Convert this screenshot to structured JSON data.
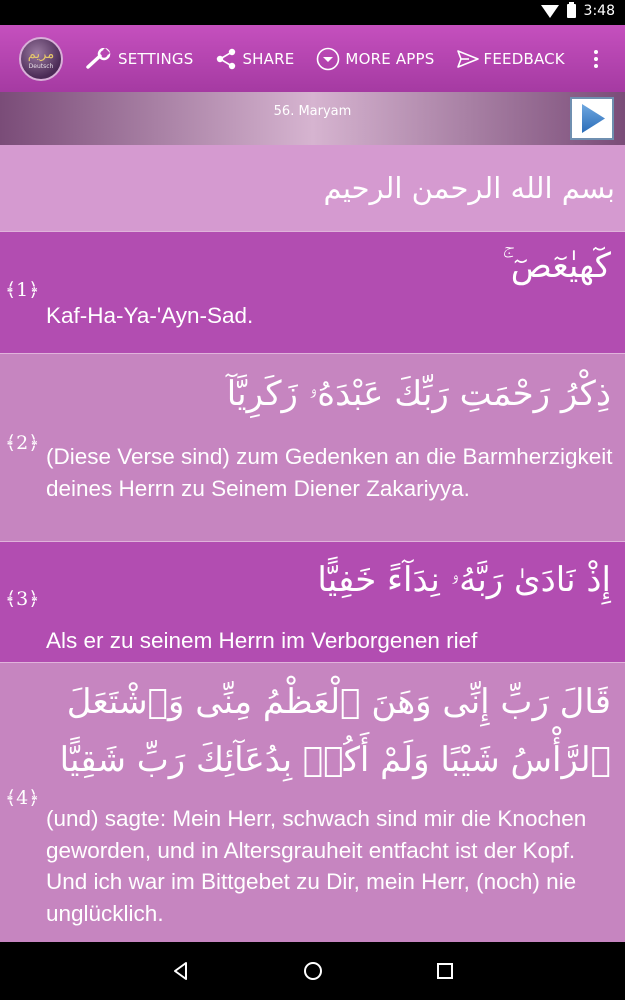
{
  "status_bar": {
    "time": "3:48"
  },
  "toolbar": {
    "logo_arabic": "مريم",
    "logo_language": "Deutsch",
    "settings_label": "SETTINGS",
    "share_label": "SHARE",
    "more_apps_label": "MORE APPS",
    "feedback_label": "FEEDBACK"
  },
  "player": {
    "sura_title": "56. Maryam"
  },
  "bismillah": "بسم الله الرحمن الرحيم",
  "verses": [
    {
      "number": "﴾1﴿",
      "arabic": "كٓهيٰعٓصٓ ۚ",
      "translation": "Kaf-Ha-Ya-'Ayn-Sad."
    },
    {
      "number": "﴾2﴿",
      "arabic": "ذِكْرُ رَحْمَتِ رَبِّكَ عَبْدَهُۥ زَكَرِيَّآ",
      "translation": "(Diese Verse sind) zum Gedenken an die Barmherzigkeit deines Herrn zu Seinem Diener Zakariyya."
    },
    {
      "number": "﴾3﴿",
      "arabic": "إِذْ نَادَىٰ رَبَّهُۥ نِدَآءً خَفِيًّا",
      "translation": "Als er zu seinem Herrn im Verborgenen rief"
    },
    {
      "number": "﴾4﴿",
      "arabic": "قَالَ رَبِّ إِنِّى وَهَنَ ٱلْعَظْمُ مِنِّى وَٱشْتَعَلَ ٱلرَّأْسُ شَيْبًا وَلَمْ أَكُنۢ بِدُعَآئِكَ رَبِّ شَقِيًّا",
      "translation": "(und) sagte: Mein Herr, schwach sind mir die Knochen geworden, und in  Altersgrauheit entfacht ist der Kopf. Und ich war im Bittgebet zu Dir,  mein Herr, (noch) nie unglücklich."
    }
  ]
}
